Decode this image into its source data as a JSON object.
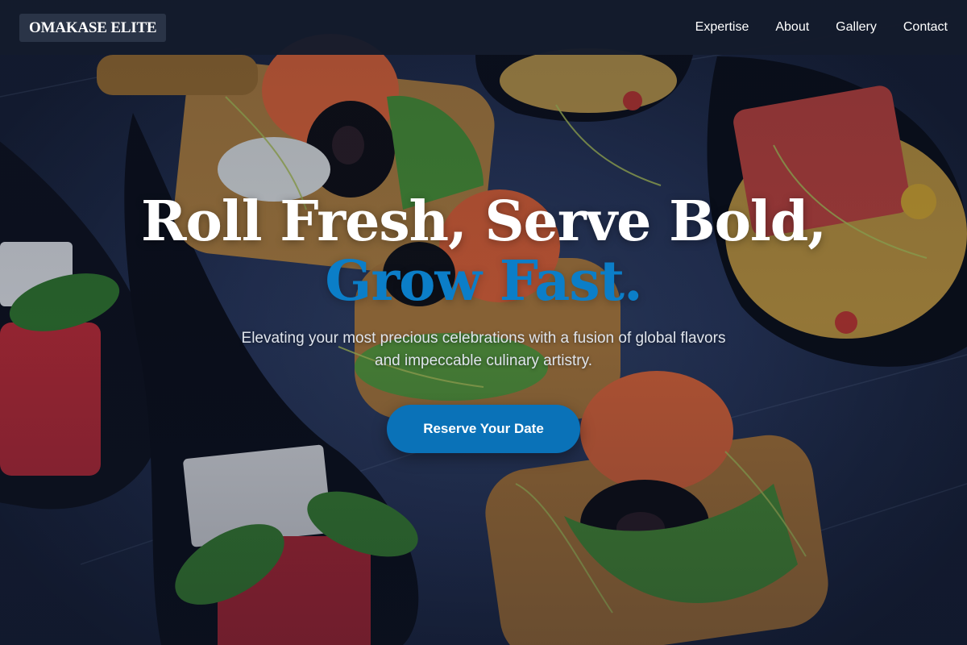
{
  "nav": {
    "logo": "OMAKASE ELITE",
    "links": [
      "Expertise",
      "About",
      "Gallery",
      "Contact"
    ]
  },
  "hero": {
    "headline_line1": "Roll Fresh, Serve Bold,",
    "headline_line2": "Grow Fast.",
    "subtitle_line1": "Elevating your most precious celebrations with a fusion of global flavors",
    "subtitle_line2": "and impeccable culinary artistry.",
    "cta_label": "Reserve Your Date"
  },
  "colors": {
    "nav_background": "#141b2c",
    "logo_background": "#2a3447",
    "accent": "#0b7ec8",
    "button": "#0a72b8",
    "text": "#ffffff"
  },
  "background_image": "catering canapés on dark slate: salmon rolls with olives and greens on toast, tuna tartare in black spoons, watermelon and feta cubes with basil"
}
